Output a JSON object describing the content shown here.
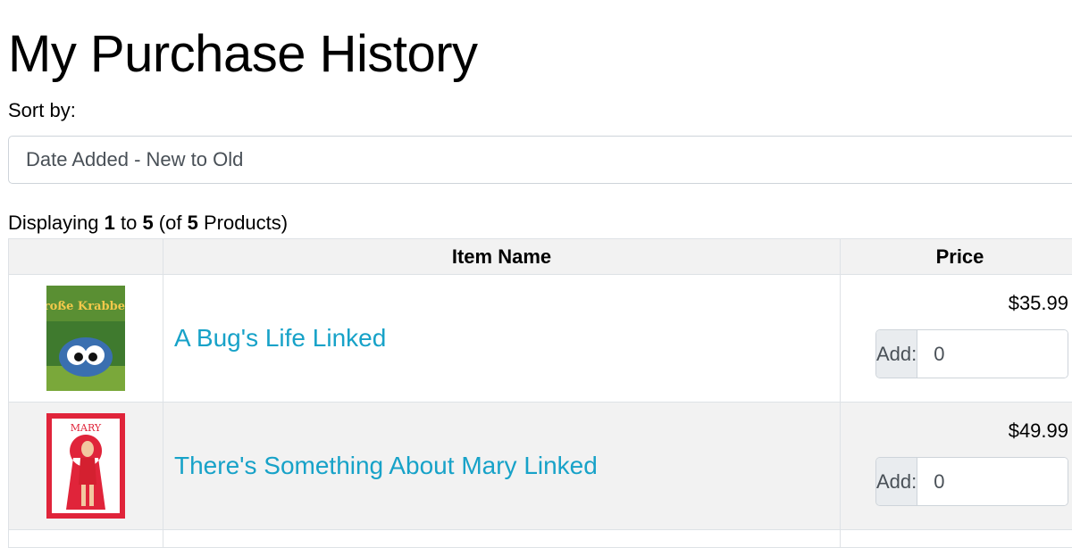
{
  "page": {
    "title": "My Purchase History"
  },
  "sort": {
    "label": "Sort by:",
    "selected": "Date Added - New to Old"
  },
  "count": {
    "prefix": "Displaying ",
    "from": "1",
    "to_word": " to ",
    "to": "5",
    "of_prefix": " (of ",
    "total": "5",
    "suffix": " Products)"
  },
  "table": {
    "headers": {
      "image": "",
      "name": "Item Name",
      "price": "Price"
    },
    "rows": [
      {
        "name": "A Bug's Life Linked",
        "price": "$35.99",
        "add_label": "Add:",
        "qty": "0",
        "cover_text": "Große Krabbeln"
      },
      {
        "name": "There's Something About Mary Linked",
        "price": "$49.99",
        "add_label": "Add:",
        "qty": "0",
        "cover_text": "MARY"
      }
    ]
  },
  "colors": {
    "link": "#17a2c8",
    "stripe": "#f2f2f2",
    "border": "#dee2e6"
  }
}
